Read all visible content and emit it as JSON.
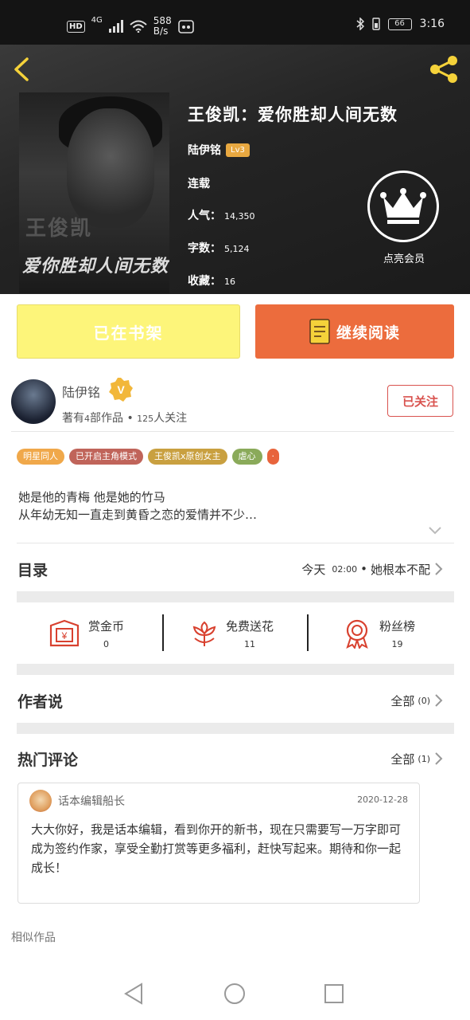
{
  "status_bar": {
    "hd": "HD",
    "network": "4G",
    "speed_value": "588",
    "speed_unit": "B/s",
    "battery_level": "66",
    "time": "3:16"
  },
  "book": {
    "title": "王俊凯：爱你胜却人间无数",
    "author": "陆伊铭",
    "author_level": "Lv3",
    "status": "连载",
    "popularity_label": "人气：",
    "popularity_value": "14,350",
    "word_count_label": "字数：",
    "word_count_value": "5,124",
    "favorites_label": "收藏：",
    "favorites_value": "16",
    "cover_text_1": "王俊凯",
    "cover_text_2": "爱你胜却人间无数"
  },
  "vip": {
    "label": "点亮会员"
  },
  "actions": {
    "shelf_label": "已在书架",
    "read_label": "继续阅读"
  },
  "author_card": {
    "name": "陆伊铭",
    "works_prefix": "著有",
    "works_count": "4",
    "works_suffix": "部作品 • ",
    "followers_count": "125",
    "followers_suffix": "人关注",
    "follow_button": "已关注"
  },
  "tags": [
    {
      "label": "明星同人",
      "color": "#f0a84a"
    },
    {
      "label": "已开启主角模式",
      "color": "#c0645a"
    },
    {
      "label": "王俊凯x原创女主",
      "color": "#c9a040"
    },
    {
      "label": "虐心",
      "color": "#8aaa5a"
    },
    {
      "label": "·",
      "color": "#e8643c"
    }
  ],
  "description": {
    "line1": "她是他的青梅  他是她的竹马",
    "line2": "从年幼无知一直走到黄昏之恋的爱情并不少…"
  },
  "catalog": {
    "title": "目录",
    "latest_day": "今天",
    "latest_time": "02:00",
    "latest_sep": " • ",
    "latest_chapter": "她根本不配"
  },
  "stats": [
    {
      "label": "赏金币",
      "value": "0",
      "icon": "envelope-yen-icon"
    },
    {
      "label": "免费送花",
      "value": "11",
      "icon": "flower-icon"
    },
    {
      "label": "粉丝榜",
      "value": "19",
      "icon": "medal-icon"
    }
  ],
  "author_says": {
    "title": "作者说",
    "all_label": "全部",
    "count": "(0)"
  },
  "hot_comments": {
    "title": "热门评论",
    "all_label": "全部",
    "count": "(1)"
  },
  "comment": {
    "user": "话本编辑船长",
    "date": "2020-12-28",
    "body": "大大你好，我是话本编辑，看到你开的新书，现在只需要写一万字即可成为签约作家，享受全勤打赏等更多福利，赶快写起来。期待和你一起成长！"
  },
  "similar": {
    "title": "相似作品"
  },
  "colors": {
    "accent_orange": "#ec6c3d",
    "shelf_yellow": "#fdf57a",
    "follow_red": "#d9534f",
    "back_arrow_yellow": "#f5d23a"
  }
}
